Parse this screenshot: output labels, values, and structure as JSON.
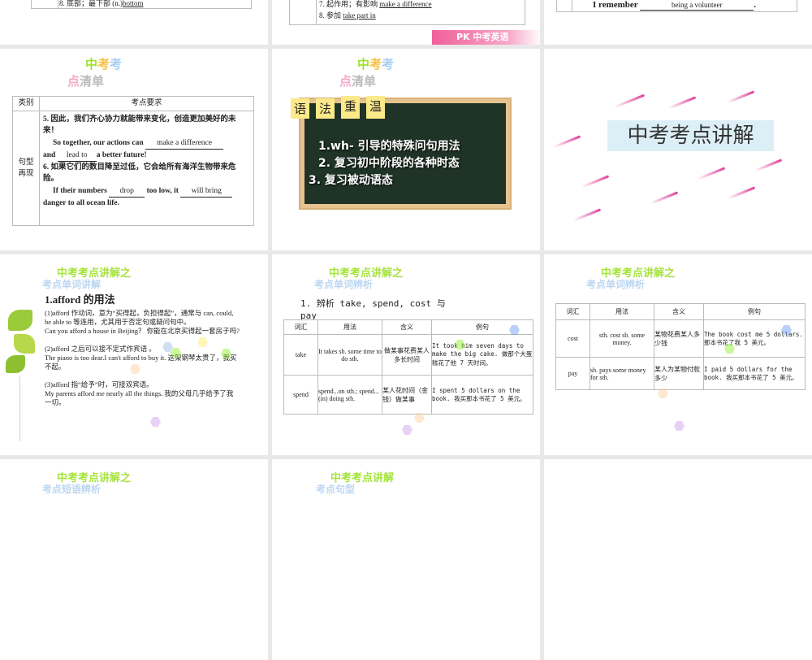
{
  "slides": [
    {
      "id": 1,
      "row_text": "8.  底部；最下部 (n.)",
      "answer": "bottom"
    },
    {
      "id": 2,
      "rows": [
        {
          "label": "7.  起作用；有影响",
          "answer": "make a difference"
        },
        {
          "label": "8.  参加",
          "answer": "take part in"
        }
      ],
      "badge": "PK 中考英语"
    },
    {
      "id": 3,
      "prefix": "I remember",
      "answer": "being a volunteer",
      "suffix": "."
    },
    {
      "id": 4,
      "title_a": [
        "中",
        "考",
        "考"
      ],
      "title_b": [
        "点",
        "清",
        "单"
      ],
      "headers": [
        "类别",
        "考点要求"
      ],
      "category": "句型再现",
      "s5_cn": "5.  因此，我们齐心协力就能带来变化，创造更加美好的未来！",
      "s5_en1": "So together, our actions can",
      "s5_ans1": "make a difference",
      "s5_en2": "and",
      "s5_ans2": "lead to",
      "s5_en3": "a better future!",
      "s6_cn": "6.  如果它们的数目降至过低，它会给所有海洋生物带来危险。",
      "s6_en1": "If their numbers",
      "s6_ans1": "drop",
      "s6_en2": "too low, it",
      "s6_ans2": "will bring",
      "s6_en3": "danger to all ocean life."
    },
    {
      "id": 5,
      "title_a": [
        "中",
        "考",
        "考"
      ],
      "title_b": [
        "点",
        "清",
        "单"
      ],
      "tabs": [
        "语",
        "法",
        "重",
        "温"
      ],
      "items": [
        "1.wh- 引导的特殊问句用法",
        "2. 复习初中阶段的各种时态",
        "3. 复习被动语态"
      ]
    },
    {
      "id": 6,
      "title": "中考考点讲解"
    },
    {
      "id": 7,
      "h1": "中考考点讲解之",
      "h2": "考点单词讲解",
      "heading": "1.afford 的用法",
      "p1": "(1)afford 作动词，意为“买得起，负担得起”，通常与 can, could, be able to  等连用，尤其用于否定句或疑问句中。",
      "p1_ex": "Can you afford a house in Beijing？ 你能在北京买得起一套房子吗?",
      "p2": "(2)afford 之后可以接不定式作宾语 。",
      "p2_ex": "The piano is too dear.I can't afford to buy it. 这架钢琴太贵了，我买不起。",
      "p3": "(3)afford 指“给予”时，可接双宾语。",
      "p3_ex": "My parents afford me nearly all the things. 我的父母几乎给予了我一切。"
    },
    {
      "id": 8,
      "h1": "中考考点讲解之",
      "h2": "考点单词辨析",
      "heading": "1. 辨析 take,  spend,  cost 与 pay",
      "headers": [
        "词汇",
        "用法",
        "含义",
        "例句"
      ],
      "rows": [
        [
          "take",
          "It takes sb. some time to do sth.",
          "做某事花费某人多长时间",
          "It took him seven days to make the big cake.  做那个大蛋糕花了他 7 天时间。"
        ],
        [
          "spend",
          "spend...on sth.; spend...(in) doing sth.",
          "某人花时间（金钱）做某事",
          "I spent 5 dollars on the book.  我买那本书花了 5 美元。"
        ]
      ]
    },
    {
      "id": 9,
      "h1": "中考考点讲解之",
      "h2": "考点单词辨析",
      "headers": [
        "词汇",
        "用法",
        "含义",
        "例句"
      ],
      "rows": [
        [
          "cost",
          "sth. cost sb. some money.",
          "某物花费某人多少钱",
          "The book cost me 5 dollars.  那本书花了我 5 美元。"
        ],
        [
          "pay",
          "sb. pays some money for sth.",
          "某人为某物付款多少",
          "I paid 5 dollars for the book.  我买那本书花了 5 美元。"
        ]
      ]
    },
    {
      "id": 10,
      "h1": "中考考点讲解之",
      "h2": "考点短语辨析"
    },
    {
      "id": 11,
      "h1": "中考考点讲解",
      "h2": "考点句型"
    },
    {
      "id": 12
    }
  ]
}
